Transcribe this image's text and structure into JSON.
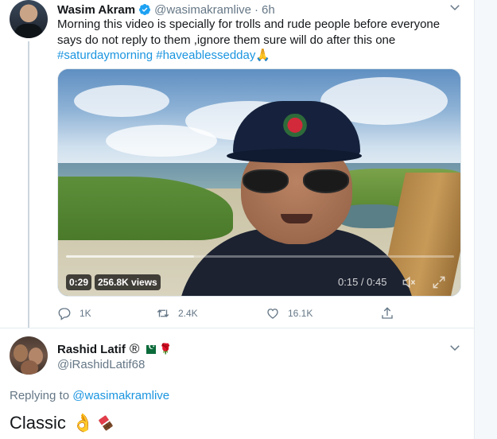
{
  "tweet1": {
    "author_name": "Wasim Akram",
    "verified": true,
    "handle": "@wasimakramlive",
    "separator": "·",
    "time": "6h",
    "text_line1": "Morning this video is specially for trolls and rude people before everyone",
    "text_line2": "says do not reply to them ,ignore them sure will do after this one",
    "hashtag1": "#saturdaymorning",
    "hashtag2": "#haveablessedday",
    "hashtag_emoji": "🙏",
    "video": {
      "duration_badge": "0:29",
      "views_badge": "256.8K views",
      "time_readout": "0:15 / 0:45",
      "progress": 0.33,
      "icons": [
        "mute-icon",
        "fullscreen-icon"
      ]
    },
    "actions": {
      "reply_count": "1K",
      "retweet_count": "2.4K",
      "like_count": "16.1K",
      "icons": [
        "reply-icon",
        "retweet-icon",
        "like-icon",
        "share-icon"
      ]
    }
  },
  "tweet2": {
    "author_name": "Rashid Latif",
    "name_symbol": "®",
    "name_emojis": [
      "pakistan-flag-icon",
      "rose-icon"
    ],
    "handle": "@iRashidLatif68",
    "replying_prefix": "Replying to",
    "replying_mention": "@wasimakramlive",
    "text": "Classic",
    "emojis": [
      "ok-hand-icon",
      "chocolate-bar-icon"
    ]
  },
  "colors": {
    "link": "#1b95e0",
    "secondary_text": "#657786",
    "primary_text": "#14171a",
    "verified": "#1da1f2"
  }
}
